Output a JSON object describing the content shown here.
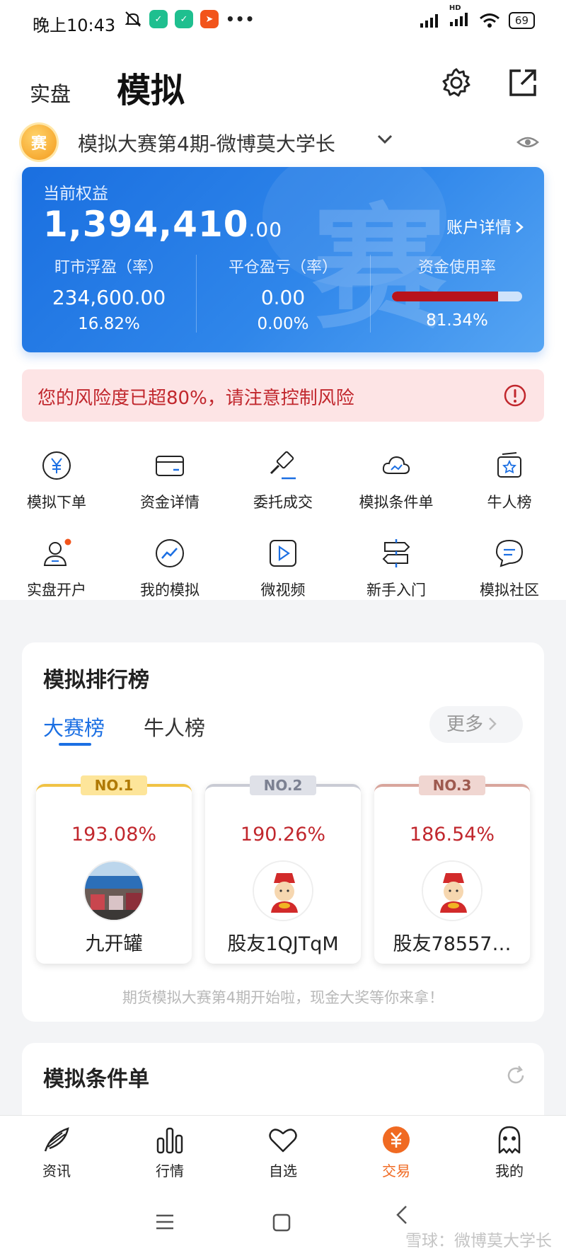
{
  "status_bar": {
    "time": "晚上10:43",
    "dots": "•••",
    "network": "HD",
    "battery": "69"
  },
  "header": {
    "tab_real": "实盘",
    "tab_sim": "模拟"
  },
  "contest": {
    "badge": "赛",
    "name": "模拟大赛第4期-微博莫大学长"
  },
  "account_card": {
    "watermark": "赛",
    "equity_label": "当前权益",
    "equity_int": "1,394,410",
    "equity_dec": ".00",
    "detail_link": "账户详情",
    "metrics": [
      {
        "title": "盯市浮盈（率）",
        "value": "234,600.00",
        "pct": "16.82%"
      },
      {
        "title": "平仓盈亏（率）",
        "value": "0.00",
        "pct": "0.00%"
      },
      {
        "title": "资金使用率",
        "pct": "81.34%",
        "fill": 0.8134
      }
    ]
  },
  "warning": {
    "text": "您的风险度已超80%，请注意控制风险"
  },
  "grid": [
    {
      "label": "模拟下单",
      "icon": "yen-circle-icon"
    },
    {
      "label": "资金详情",
      "icon": "card-icon"
    },
    {
      "label": "委托成交",
      "icon": "gavel-icon"
    },
    {
      "label": "模拟条件单",
      "icon": "cloud-icon"
    },
    {
      "label": "牛人榜",
      "icon": "star-box-icon"
    },
    {
      "label": "实盘开户",
      "icon": "person-icon"
    },
    {
      "label": "我的模拟",
      "icon": "trend-icon"
    },
    {
      "label": "微视频",
      "icon": "play-icon"
    },
    {
      "label": "新手入门",
      "icon": "signpost-icon"
    },
    {
      "label": "模拟社区",
      "icon": "chat-icon"
    }
  ],
  "ranking": {
    "title": "模拟排行榜",
    "tab_contest": "大赛榜",
    "tab_experts": "牛人榜",
    "more": "更多",
    "entries": [
      {
        "badge": "NO.1",
        "pct": "193.08%",
        "name": "九开罐"
      },
      {
        "badge": "NO.2",
        "pct": "190.26%",
        "name": "股友1QJTqM"
      },
      {
        "badge": "NO.3",
        "pct": "186.54%",
        "name": "股友78557…"
      }
    ],
    "note": "期货模拟大赛第4期开始啦，现金大奖等你来拿！"
  },
  "condition": {
    "title": "模拟条件单"
  },
  "bottom_nav": [
    {
      "label": "资讯",
      "icon": "feather-icon"
    },
    {
      "label": "行情",
      "icon": "bars-icon"
    },
    {
      "label": "自选",
      "icon": "heart-icon"
    },
    {
      "label": "交易",
      "icon": "yen-coin-icon",
      "active": true
    },
    {
      "label": "我的",
      "icon": "ghost-icon"
    }
  ],
  "colors": {
    "brand_blue": "#1b6fe3",
    "alert_red": "#c1272d",
    "active_orange": "#f06a22"
  },
  "watermark": "雪球：微博莫大学长"
}
